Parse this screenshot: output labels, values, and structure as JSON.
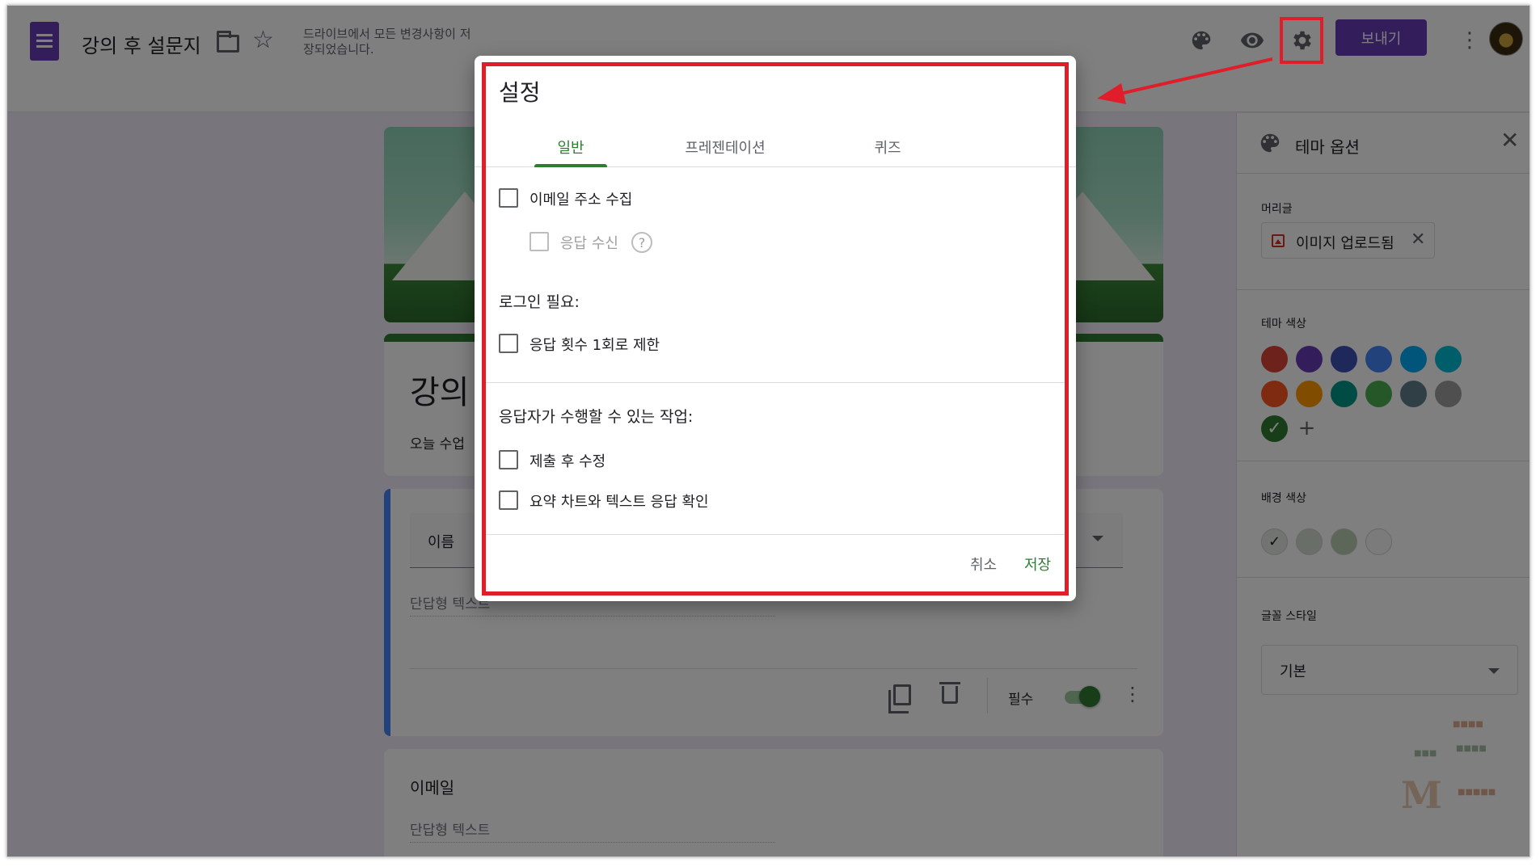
{
  "topbar": {
    "doc_title": "강의 후 설문지",
    "save_status": "드라이브에서 모든 변경사항이 저장되었습니다.",
    "send_label": "보내기",
    "icons": [
      "palette-icon",
      "eye-icon",
      "gear-icon",
      "more-vert-icon"
    ]
  },
  "form": {
    "title": "강의",
    "description": "오늘 수업",
    "question1": {
      "title": "이름",
      "short_answer": "단답형 텍스트",
      "required_label": "필수"
    },
    "question2": {
      "title": "이메일",
      "short_answer": "단답형 텍스트"
    }
  },
  "theme_panel": {
    "title": "테마 옵션",
    "header_label": "머리글",
    "image_uploaded": "이미지 업로드됨",
    "theme_color_label": "테마 색상",
    "theme_colors": [
      "#db4437",
      "#673ab7",
      "#3f51b5",
      "#4285f4",
      "#03a9f4",
      "#00bcd4",
      "#ff5722",
      "#ff9800",
      "#009688",
      "#4caf50",
      "#607d8b",
      "#9e9e9e",
      "#2e7d32"
    ],
    "background_color_label": "배경 색상",
    "background_colors": [
      "#e3e8e0",
      "#d4ddd1",
      "#b9ccb3",
      "#f7f7f7"
    ],
    "font_style_label": "글꼴 스타일",
    "font_style_value": "기본"
  },
  "dialog": {
    "title": "설정",
    "tabs": [
      "일반",
      "프레젠테이션",
      "퀴즈"
    ],
    "active_tab": "일반",
    "collect_email": "이메일 주소 수집",
    "response_receipts": "응답 수신",
    "help_symbol": "?",
    "login_required": "로그인 필요:",
    "limit_one_response": "응답 횟수 1회로 제한",
    "respondents_can": "응답자가 수행할 수 있는 작업:",
    "edit_after_submit": "제출 후 수정",
    "see_summary": "요약 차트와 텍스트 응답 확인",
    "cancel": "취소",
    "save": "저장"
  },
  "accent_colors": {
    "form_purple": "#673ab7",
    "dialog_green": "#2e7d32",
    "annotation_red": "#e01e2a"
  }
}
